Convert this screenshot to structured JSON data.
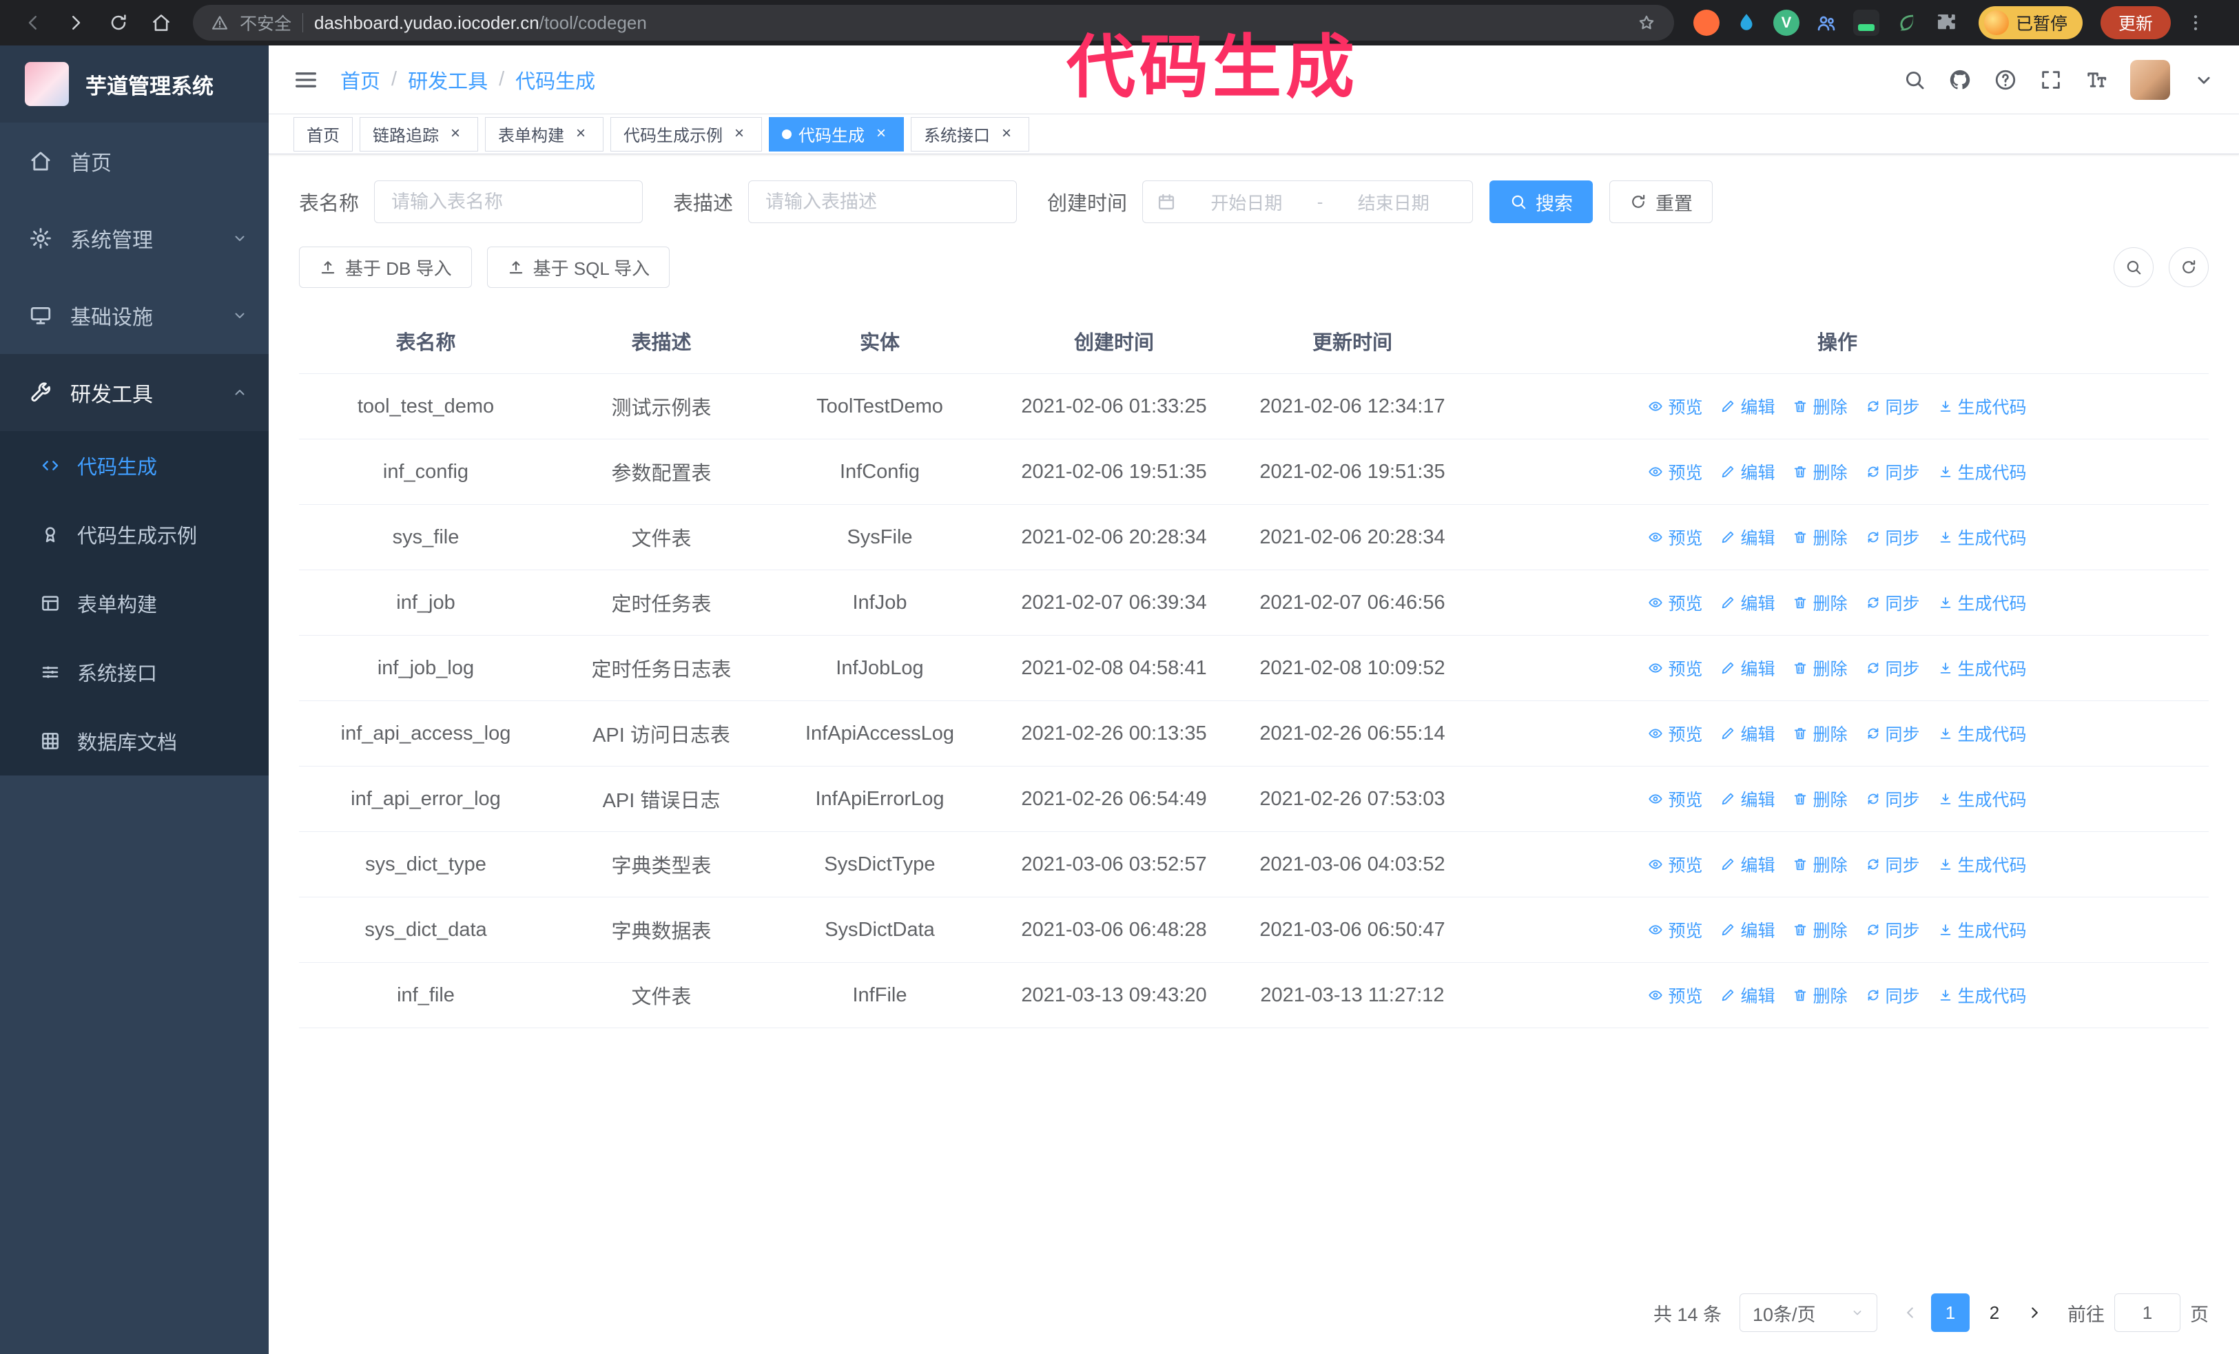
{
  "colors": {
    "primary": "#409eff",
    "annotation": "#fb2f63"
  },
  "annotation": {
    "text": "代码生成"
  },
  "browser": {
    "security_label": "不安全",
    "url_host": "dashboard.yudao.iocoder.cn",
    "url_path": "/tool/codegen",
    "profile_chip": "已暂停",
    "update_button": "更新"
  },
  "sidebar": {
    "logo_title": "芋道管理系统",
    "items": [
      {
        "label": "首页",
        "icon": "home",
        "expandable": false,
        "expanded": false
      },
      {
        "label": "系统管理",
        "icon": "gear",
        "expandable": true,
        "expanded": false
      },
      {
        "label": "基础设施",
        "icon": "monitor",
        "expandable": true,
        "expanded": false
      },
      {
        "label": "研发工具",
        "icon": "tool",
        "expandable": true,
        "expanded": true
      }
    ],
    "subitems": [
      {
        "label": "代码生成",
        "icon": "code",
        "active": true
      },
      {
        "label": "代码生成示例",
        "icon": "badge",
        "active": false
      },
      {
        "label": "表单构建",
        "icon": "form",
        "active": false
      },
      {
        "label": "系统接口",
        "icon": "api",
        "active": false
      },
      {
        "label": "数据库文档",
        "icon": "db",
        "active": false
      }
    ]
  },
  "header": {
    "breadcrumb": [
      "首页",
      "研发工具",
      "代码生成"
    ]
  },
  "tabs": [
    {
      "label": "首页",
      "closable": false,
      "active": false
    },
    {
      "label": "链路追踪",
      "closable": true,
      "active": false
    },
    {
      "label": "表单构建",
      "closable": true,
      "active": false
    },
    {
      "label": "代码生成示例",
      "closable": true,
      "active": false
    },
    {
      "label": "代码生成",
      "closable": true,
      "active": true
    },
    {
      "label": "系统接口",
      "closable": true,
      "active": false
    }
  ],
  "filters": {
    "table_name_label": "表名称",
    "table_name_placeholder": "请输入表名称",
    "table_desc_label": "表描述",
    "table_desc_placeholder": "请输入表描述",
    "create_time_label": "创建时间",
    "date_start_placeholder": "开始日期",
    "date_separator": "-",
    "date_end_placeholder": "结束日期",
    "search_label": "搜索",
    "reset_label": "重置"
  },
  "toolbar": {
    "import_db_label": "基于 DB 导入",
    "import_sql_label": "基于 SQL 导入"
  },
  "table": {
    "columns": [
      "表名称",
      "表描述",
      "实体",
      "创建时间",
      "更新时间",
      "操作"
    ],
    "actions": [
      {
        "name": "preview",
        "icon": "eye",
        "label": "预览"
      },
      {
        "name": "edit",
        "icon": "edit",
        "label": "编辑"
      },
      {
        "name": "delete",
        "icon": "del",
        "label": "删除"
      },
      {
        "name": "sync",
        "icon": "sync",
        "label": "同步"
      },
      {
        "name": "generate-code",
        "icon": "download",
        "label": "生成代码"
      }
    ],
    "rows": [
      {
        "name": "tool_test_demo",
        "desc": "测试示例表",
        "entity": "ToolTestDemo",
        "created": "2021-02-06 01:33:25",
        "updated": "2021-02-06 12:34:17"
      },
      {
        "name": "inf_config",
        "desc": "参数配置表",
        "entity": "InfConfig",
        "created": "2021-02-06 19:51:35",
        "updated": "2021-02-06 19:51:35"
      },
      {
        "name": "sys_file",
        "desc": "文件表",
        "entity": "SysFile",
        "created": "2021-02-06 20:28:34",
        "updated": "2021-02-06 20:28:34"
      },
      {
        "name": "inf_job",
        "desc": "定时任务表",
        "entity": "InfJob",
        "created": "2021-02-07 06:39:34",
        "updated": "2021-02-07 06:46:56"
      },
      {
        "name": "inf_job_log",
        "desc": "定时任务日志表",
        "entity": "InfJobLog",
        "created": "2021-02-08 04:58:41",
        "updated": "2021-02-08 10:09:52"
      },
      {
        "name": "inf_api_access_log",
        "desc": "API 访问日志表",
        "entity": "InfApiAccessLog",
        "created": "2021-02-26 00:13:35",
        "updated": "2021-02-26 06:55:14"
      },
      {
        "name": "inf_api_error_log",
        "desc": "API 错误日志",
        "entity": "InfApiErrorLog",
        "created": "2021-02-26 06:54:49",
        "updated": "2021-02-26 07:53:03"
      },
      {
        "name": "sys_dict_type",
        "desc": "字典类型表",
        "entity": "SysDictType",
        "created": "2021-03-06 03:52:57",
        "updated": "2021-03-06 04:03:52"
      },
      {
        "name": "sys_dict_data",
        "desc": "字典数据表",
        "entity": "SysDictData",
        "created": "2021-03-06 06:48:28",
        "updated": "2021-03-06 06:50:47"
      },
      {
        "name": "inf_file",
        "desc": "文件表",
        "entity": "InfFile",
        "created": "2021-03-13 09:43:20",
        "updated": "2021-03-13 11:27:12"
      }
    ]
  },
  "pagination": {
    "total_label": "共 14 条",
    "page_size_label": "10条/页",
    "pages": [
      "1",
      "2"
    ],
    "active_page": "1",
    "goto_label": "前往",
    "goto_value": "1",
    "goto_suffix": "页"
  }
}
